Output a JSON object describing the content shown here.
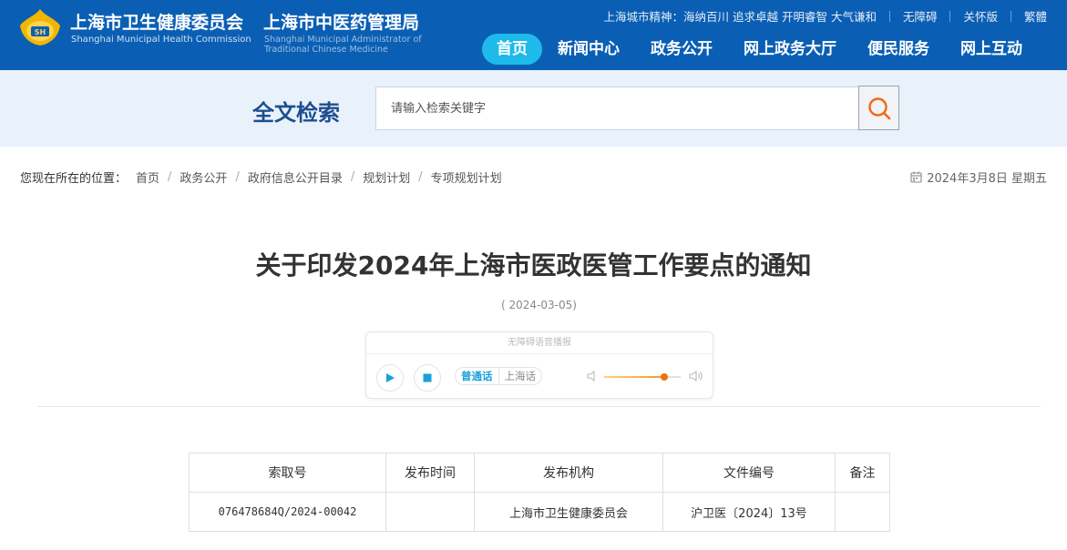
{
  "header": {
    "org_cn": "上海市卫生健康委员会",
    "org_en": "Shanghai Municipal Health Commission",
    "org2_cn": "上海市中医药管理局",
    "org2_en_line1": "Shanghai Municipal Administrator of",
    "org2_en_line2": "Traditional Chinese Medicine",
    "spirit": "上海城市精神：海纳百川 追求卓越 开明睿智 大气谦和",
    "accessibility": "无障碍",
    "care_version": "关怀版",
    "traditional": "繁體",
    "brand_color": "#0a5fb4",
    "accent_color": "#1ebbea"
  },
  "nav": {
    "items": [
      {
        "label": "首页",
        "active": true
      },
      {
        "label": "新闻中心"
      },
      {
        "label": "政务公开"
      },
      {
        "label": "网上政务大厅"
      },
      {
        "label": "便民服务"
      },
      {
        "label": "网上互动"
      }
    ]
  },
  "search": {
    "title": "全文检索",
    "placeholder": "请输入检索关键字",
    "button_icon": "search-icon"
  },
  "breadcrumb": {
    "lead": "您现在所在的位置：",
    "items": [
      "首页",
      "政务公开",
      "政府信息公开目录",
      "规划计划",
      "专项规划计划"
    ]
  },
  "today": "2024年3月8日 星期五",
  "article": {
    "title": "关于印发2024年上海市医政医管工作要点的通知",
    "date": "( 2024-03-05)"
  },
  "player": {
    "heading": "无障碍语音播报",
    "dialect_mandarin": "普通话",
    "dialect_shanghai": "上海话",
    "volume": 0.78
  },
  "info_table": {
    "headers": [
      "索取号",
      "发布时间",
      "发布机构",
      "文件编号",
      "备注"
    ],
    "row": [
      "076478684Q/2024-00042",
      "",
      "上海市卫生健康委员会",
      "沪卫医〔2024〕13号",
      ""
    ]
  }
}
